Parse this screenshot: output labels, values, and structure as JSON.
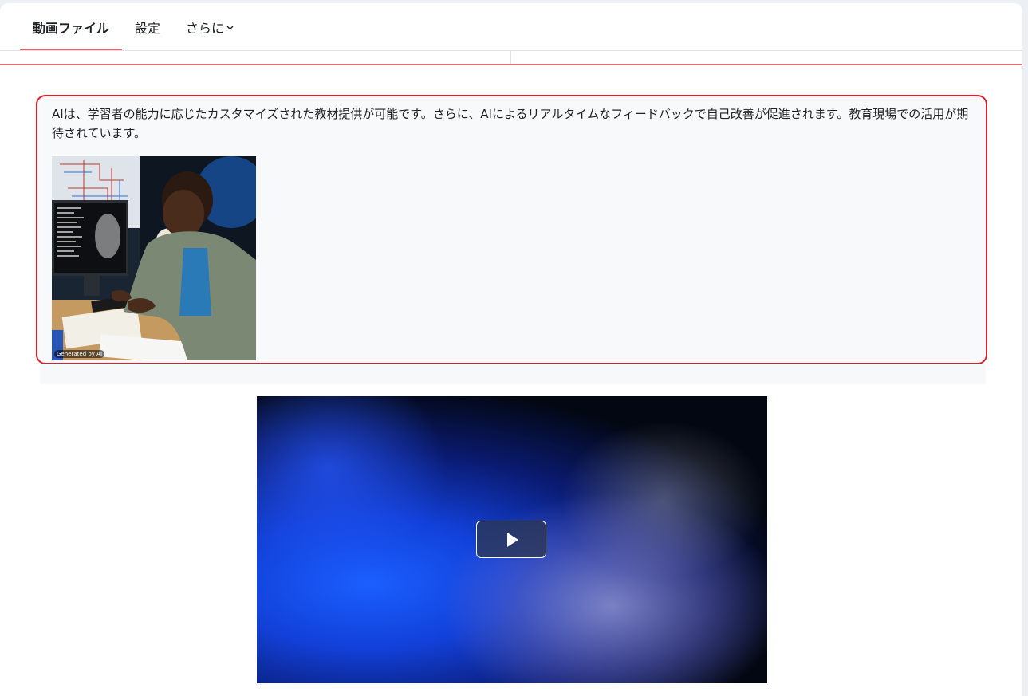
{
  "tabs": {
    "items": [
      {
        "label": "動画ファイル",
        "active": true
      },
      {
        "label": "設定",
        "active": false
      },
      {
        "label": "さらに",
        "active": false,
        "icon": "chevron-down-icon"
      }
    ]
  },
  "content": {
    "paragraph": "AIは、学習者の能力に応じたカスタマイズされた教材提供が可能です。さらに、AIによるリアルタイムなフィードバックで自己改善が促進されます。教育現場での活用が期待されています。",
    "image_badge": "Generated by AI"
  },
  "video": {
    "play_icon": "play-icon"
  },
  "colors": {
    "accent": "#e0646f",
    "highlight_border": "#d9202c",
    "box_background": "#f7f9fb"
  }
}
